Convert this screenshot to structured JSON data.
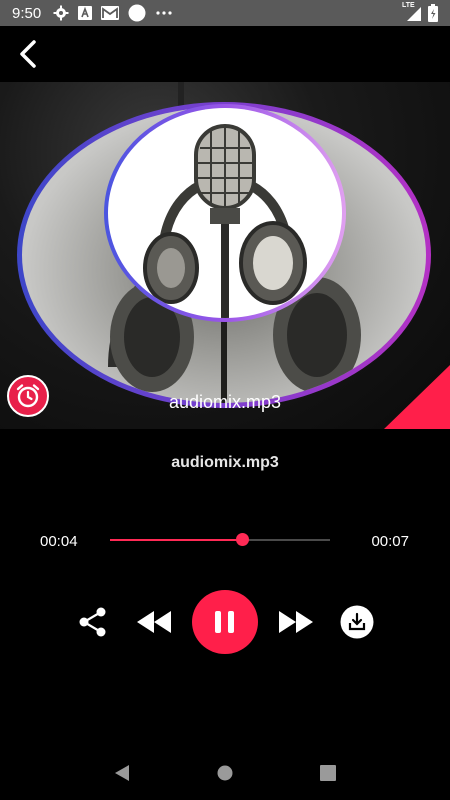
{
  "status_bar": {
    "time": "9:50",
    "network_label": "LTE",
    "icons": [
      "settings-icon",
      "font-icon",
      "gmail-icon",
      "circle-icon",
      "more-dots-icon",
      "signal-icon",
      "battery-icon"
    ]
  },
  "artwork": {
    "title": "audiomix.mp3",
    "accent_color": "#ff1f4a",
    "ring_colors": [
      "#3d47c9",
      "#b431c4"
    ]
  },
  "player": {
    "track_title": "audiomix.mp3",
    "time_current": "00:04",
    "time_total": "00:07",
    "progress": 0.6,
    "is_playing": true
  },
  "controls": [
    "share-icon",
    "rewind-icon",
    "pause-icon",
    "fast-forward-icon",
    "download-icon"
  ],
  "nav_bar": [
    "back-triangle-icon",
    "home-circle-icon",
    "recents-square-icon"
  ]
}
